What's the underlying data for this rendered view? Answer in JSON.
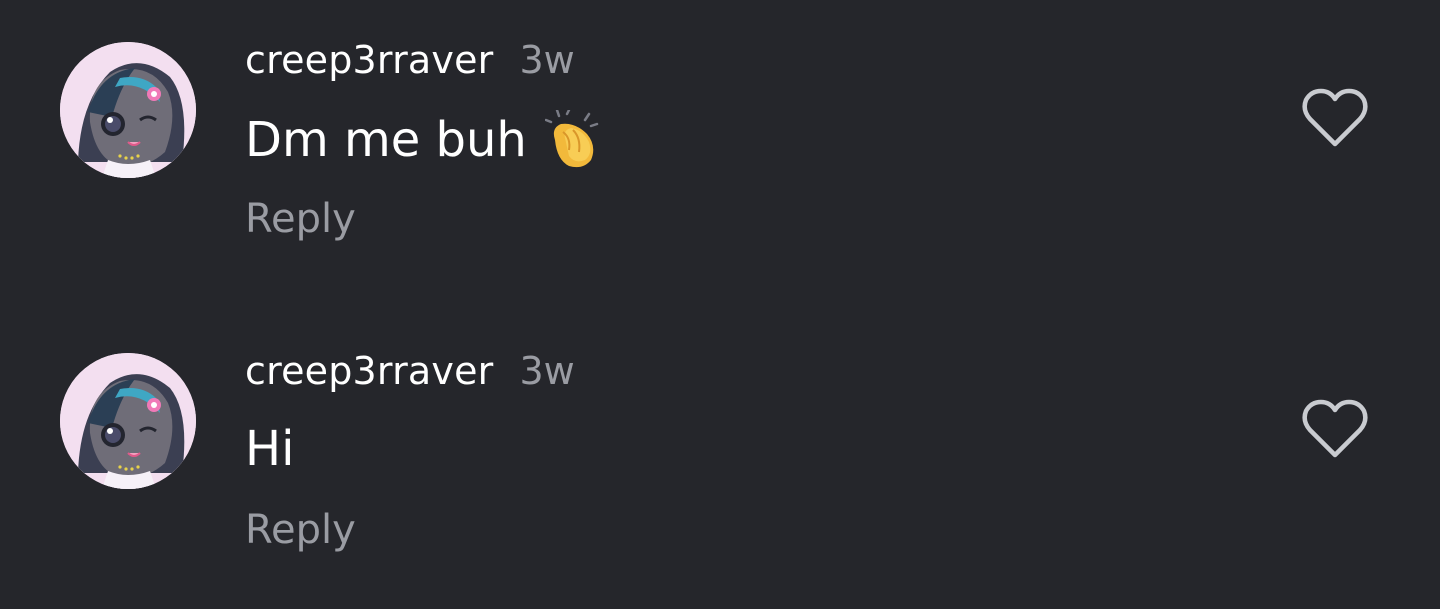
{
  "comments": [
    {
      "username": "creep3rraver",
      "time": "3w",
      "text": "Dm me buh",
      "emoji": "clapping-hands",
      "reply_label": "Reply",
      "avatar": "anime-avatar-icon"
    },
    {
      "username": "creep3rraver",
      "time": "3w",
      "text": "Hi",
      "emoji": "",
      "reply_label": "Reply",
      "avatar": "anime-avatar-icon"
    }
  ],
  "colors": {
    "background": "#25262b",
    "primary_text": "#ffffff",
    "secondary_text": "#9a9ca3",
    "heart_outline": "#c9cbd0"
  },
  "icons": {
    "like": "heart-outline-icon"
  }
}
